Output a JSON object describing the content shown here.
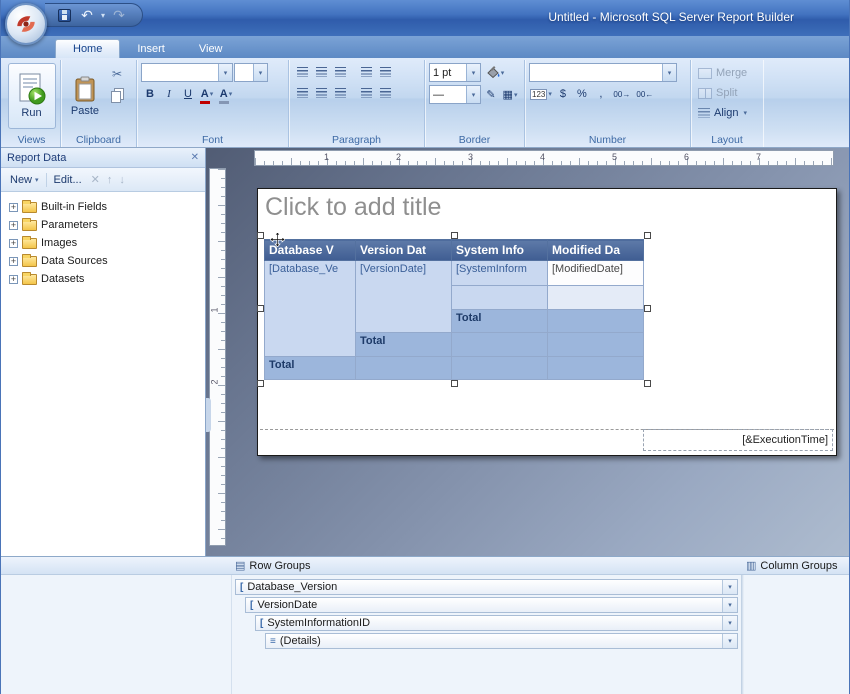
{
  "window": {
    "title": "Untitled - Microsoft SQL Server Report Builder"
  },
  "tabs": {
    "home": "Home",
    "insert": "Insert",
    "view": "View"
  },
  "ribbon": {
    "views": {
      "label": "Views",
      "run": "Run"
    },
    "clipboard": {
      "label": "Clipboard",
      "paste": "Paste"
    },
    "font": {
      "label": "Font",
      "bold": "B",
      "italic": "I",
      "underline": "U",
      "color": "A",
      "color2": "A"
    },
    "paragraph": {
      "label": "Paragraph"
    },
    "border": {
      "label": "Border",
      "width": "1 pt",
      "line": "—"
    },
    "number": {
      "label": "Number",
      "fmt": "123",
      "currency": "$",
      "percent": "%",
      "comma": ",",
      "inc_decimal": "00→",
      "dec_decimal": "00←"
    },
    "layout": {
      "label": "Layout",
      "merge": "Merge",
      "split": "Split",
      "align": "Align"
    }
  },
  "report_data": {
    "title": "Report Data",
    "new": "New",
    "edit": "Edit...",
    "tree": [
      {
        "label": "Built-in Fields"
      },
      {
        "label": "Parameters"
      },
      {
        "label": "Images"
      },
      {
        "label": "Data Sources"
      },
      {
        "label": "Datasets"
      }
    ]
  },
  "rulers": {
    "horizontal": [
      "1",
      "2",
      "3",
      "4",
      "5",
      "6",
      "7"
    ],
    "vertical": [
      "1",
      "2"
    ]
  },
  "design": {
    "title_placeholder": "Click to add title",
    "execution_time": "[&ExecutionTime]",
    "table": {
      "headers": [
        "Database V",
        "Version Dat",
        "System Info",
        "Modified Da"
      ],
      "fields": [
        "[Database_Ve",
        "[VersionDate]",
        "[SystemInform",
        "[ModifiedDate]"
      ],
      "total": "Total"
    }
  },
  "groups": {
    "row_groups_title": "Row Groups",
    "column_groups_title": "Column Groups",
    "rows": [
      {
        "label": "Database_Version",
        "icon": "["
      },
      {
        "label": "VersionDate",
        "icon": "["
      },
      {
        "label": "SystemInformationID",
        "icon": "["
      },
      {
        "label": "(Details)",
        "icon": "≡"
      }
    ]
  },
  "icons": {
    "caret_down": "▾",
    "close": "✕",
    "delete": "✕",
    "up": "↑",
    "down": "↓",
    "undo": "↶",
    "redo": "↷",
    "cut": "✂",
    "pencil": "✎",
    "borders_grid": "▦",
    "row_groups": "▤",
    "column_groups": "▥",
    "plus": "+"
  }
}
